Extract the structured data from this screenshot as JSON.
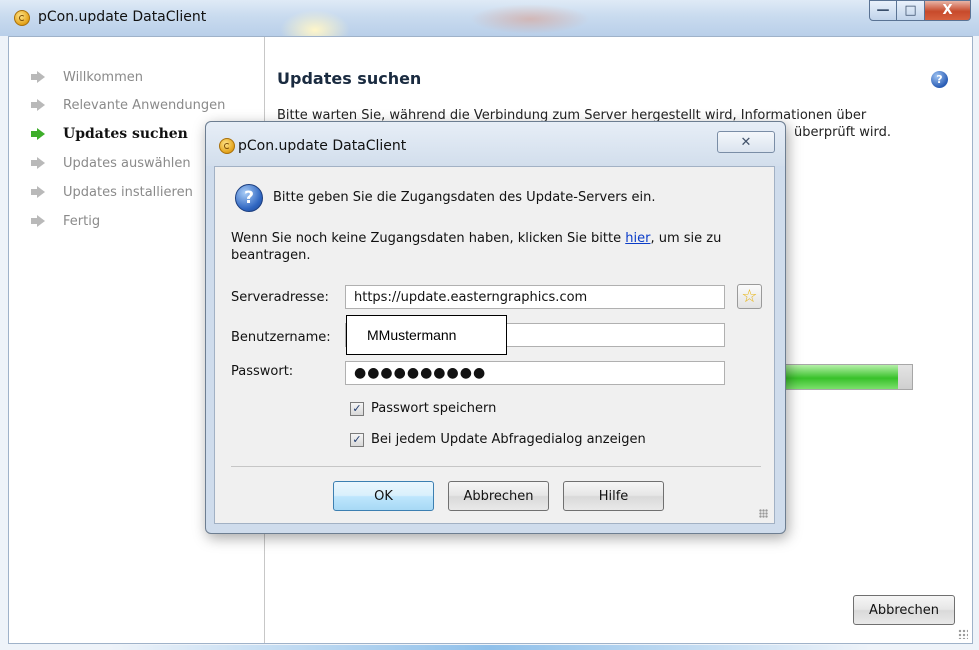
{
  "window": {
    "title": "pCon.update DataClient",
    "minimize_symbol": "—",
    "maximize_symbol": "□",
    "close_symbol": "X"
  },
  "sidebar": {
    "items": [
      {
        "label": "Willkommen",
        "active": false
      },
      {
        "label": "Relevante Anwendungen",
        "active": false
      },
      {
        "label": "Updates suchen",
        "active": true
      },
      {
        "label": "Updates auswählen",
        "active": false
      },
      {
        "label": "Updates installieren",
        "active": false
      },
      {
        "label": "Fertig",
        "active": false
      }
    ]
  },
  "main": {
    "title": "Updates suchen",
    "text_line1": "Bitte warten Sie, während die Verbindung zum Server hergestellt wird, Informationen über",
    "text_line2_end": "überprüft wird.",
    "help_symbol": "?",
    "progress_fraction": 0.9,
    "cancel_label": "Abbrechen"
  },
  "dialog": {
    "title": "pCon.update DataClient",
    "close_symbol": "✕",
    "lead": "Bitte geben Sie die Zugangsdaten des Update-Servers ein.",
    "info_before": "Wenn Sie noch keine Zugangsdaten haben, klicken Sie bitte ",
    "info_link": "hier",
    "info_after": ", um sie zu beantragen.",
    "server_label": "Serveradresse:",
    "server_value": "https://update.easterngraphics.com",
    "user_label": "Benutzername:",
    "user_value": "MMustermann",
    "password_label": "Passwort:",
    "password_value": "●●●●●●●●●●",
    "save_password_label": "Passwort speichern",
    "save_password_checked": true,
    "show_dialog_label": "Bei jedem Update Abfragedialog anzeigen",
    "show_dialog_checked": true,
    "ok_label": "OK",
    "cancel_label": "Abbrechen",
    "help_label": "Hilfe",
    "favorite_icon": "star-icon",
    "checkmark": "✓"
  },
  "colors": {
    "active_step_arrow": "#3eae2a",
    "progress_fill": "#38c12a",
    "link": "#0a3cc8",
    "ok_button_border": "#3c7fb1"
  }
}
